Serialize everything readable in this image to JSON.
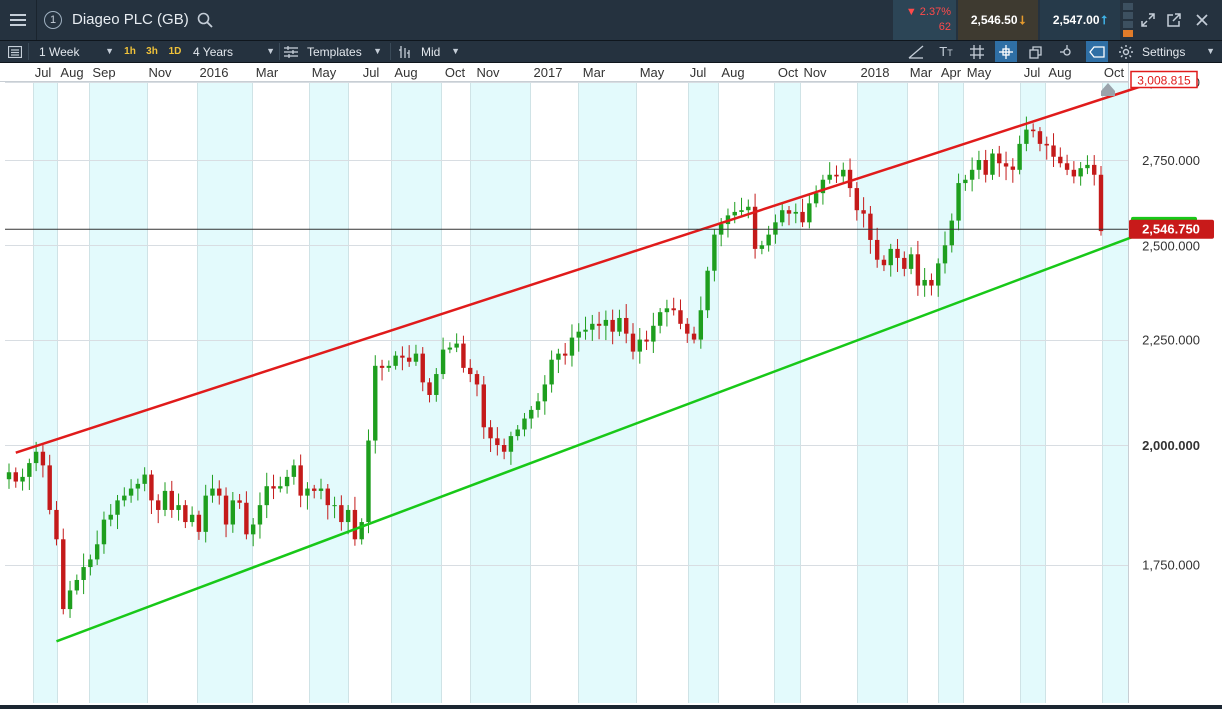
{
  "window": {
    "instrument_name": "Diageo PLC (GB)",
    "info_badge": "1",
    "change_percent": "2.37%",
    "change_value": "62",
    "sell_price": "2,546.50",
    "buy_price": "2,547.00"
  },
  "toolbar": {
    "interval": "1 Week",
    "quick_intervals": [
      "1h",
      "3h",
      "1D"
    ],
    "range": "4 Years",
    "templates_label": "Templates",
    "price_type": "Mid",
    "settings_label": "Settings"
  },
  "colors": {
    "upper_channel": "#e01b1b",
    "lower_channel": "#18c818",
    "up_candle": "#1e9e1e",
    "down_candle": "#c41a1a",
    "stripe": "#e3fafc",
    "last_price_tag": "#c81a1a"
  },
  "chart_data": {
    "type": "candlestick",
    "instrument": "Diageo PLC (GB)",
    "interval": "weekly",
    "x_tick_labels": [
      "Jul",
      "Aug",
      "Sep",
      "Nov",
      "2016",
      "Mar",
      "May",
      "Jul",
      "Aug",
      "Oct",
      "Nov",
      "2017",
      "Mar",
      "May",
      "Jul",
      "Aug",
      "Oct",
      "Nov",
      "2018",
      "Mar",
      "Apr",
      "May",
      "Jul",
      "Aug",
      "Oct"
    ],
    "y_tick_labels": [
      "1,750.000",
      "2,000.000",
      "2,250.000",
      "2,500.000",
      "2,750.000",
      "3,000.000"
    ],
    "y_ticks": [
      1750,
      2000,
      2250,
      2500,
      2750,
      3000
    ],
    "y_range": [
      1575,
      3000
    ],
    "y_scale": "log",
    "last_price": 2546.75,
    "last_price_label": "2,546.750",
    "upper_line_end_label": "3,008.815",
    "upper_line_end_value": 3008.815,
    "lower_line_end_value": 2555,
    "trend_lines": [
      {
        "name": "upper channel",
        "color": "red",
        "from": {
          "date": "2015-07-10",
          "price": 1983
        },
        "to": {
          "date": "2018-10-05",
          "price": 3008.815
        }
      },
      {
        "name": "lower channel",
        "color": "green",
        "from": {
          "date": "2015-08-21",
          "price": 1606
        },
        "to": {
          "date": "2018-10-05",
          "price": 2555
        }
      }
    ],
    "weekly_closes": [
      1940,
      1920,
      1930,
      1960,
      1985,
      1955,
      1860,
      1800,
      1665,
      1700,
      1720,
      1745,
      1760,
      1790,
      1840,
      1850,
      1880,
      1890,
      1905,
      1915,
      1935,
      1880,
      1860,
      1900,
      1860,
      1870,
      1835,
      1850,
      1815,
      1890,
      1905,
      1890,
      1830,
      1880,
      1875,
      1810,
      1830,
      1870,
      1910,
      1905,
      1910,
      1930,
      1955,
      1890,
      1905,
      1900,
      1905,
      1870,
      1870,
      1835,
      1860,
      1800,
      1835,
      2010,
      2185,
      2180,
      2185,
      2210,
      2205,
      2195,
      2215,
      2145,
      2115,
      2165,
      2225,
      2230,
      2240,
      2180,
      2165,
      2140,
      2040,
      2015,
      2000,
      1985,
      2020,
      2035,
      2060,
      2080,
      2100,
      2140,
      2200,
      2215,
      2210,
      2255,
      2270,
      2275,
      2290,
      2285,
      2300,
      2270,
      2305,
      2265,
      2220,
      2250,
      2245,
      2285,
      2320,
      2330,
      2325,
      2290,
      2265,
      2250,
      2325,
      2430,
      2530,
      2560,
      2585,
      2595,
      2600,
      2610,
      2490,
      2500,
      2530,
      2565,
      2600,
      2590,
      2595,
      2565,
      2620,
      2650,
      2690,
      2705,
      2700,
      2720,
      2665,
      2600,
      2590,
      2515,
      2460,
      2445,
      2490,
      2465,
      2435,
      2475,
      2390,
      2405,
      2390,
      2450,
      2500,
      2570,
      2680,
      2690,
      2720,
      2750,
      2705,
      2770,
      2740,
      2730,
      2720,
      2800,
      2845,
      2840,
      2800,
      2795,
      2760,
      2740,
      2720,
      2700,
      2725,
      2735,
      2705,
      2540
    ]
  }
}
